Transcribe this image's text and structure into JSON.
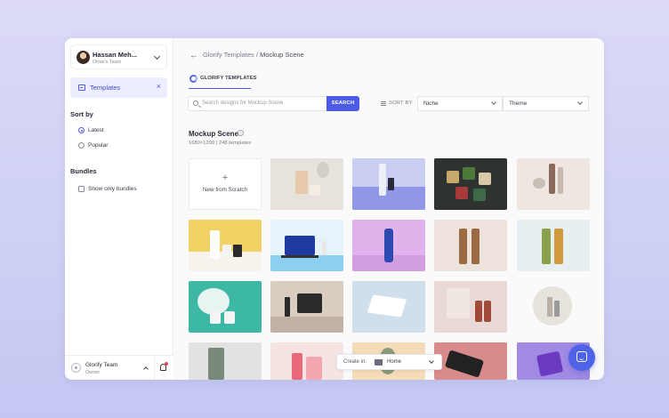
{
  "sidebar": {
    "user": {
      "name": "Hassan Meh...",
      "team": "Omar's Team"
    },
    "nav": {
      "label": "Templates",
      "close_glyph": "×"
    },
    "sort_title": "Sort by",
    "sort_options": [
      {
        "label": "Latest",
        "selected": true
      },
      {
        "label": "Popular",
        "selected": false
      }
    ],
    "bundles_title": "Bundles",
    "bundles_option": {
      "label": "Show only bundles",
      "checked": false
    },
    "team": {
      "name": "Glorify Team",
      "role": "Owner"
    }
  },
  "breadcrumb": {
    "parent": "Glorify Templates",
    "separator": "/",
    "current": "Mockup Scene"
  },
  "brand_tab": "GLORIFY TEMPLATES",
  "search": {
    "placeholder": "Search designs for Mockup Scene",
    "button": "SEARCH"
  },
  "sort_by_label": "SORT BY",
  "filters": {
    "niche": "Niche",
    "theme": "Theme"
  },
  "section": {
    "title": "Mockup Scene",
    "subtitle": "1680×1200 | 248 templates"
  },
  "new_tile": {
    "plus": "+",
    "label": "New from Scratch"
  },
  "create_in": {
    "label": "Create in:",
    "value": "Home"
  },
  "colors": {
    "accent": "#4c5ae8",
    "chat": "#4f63e8"
  }
}
